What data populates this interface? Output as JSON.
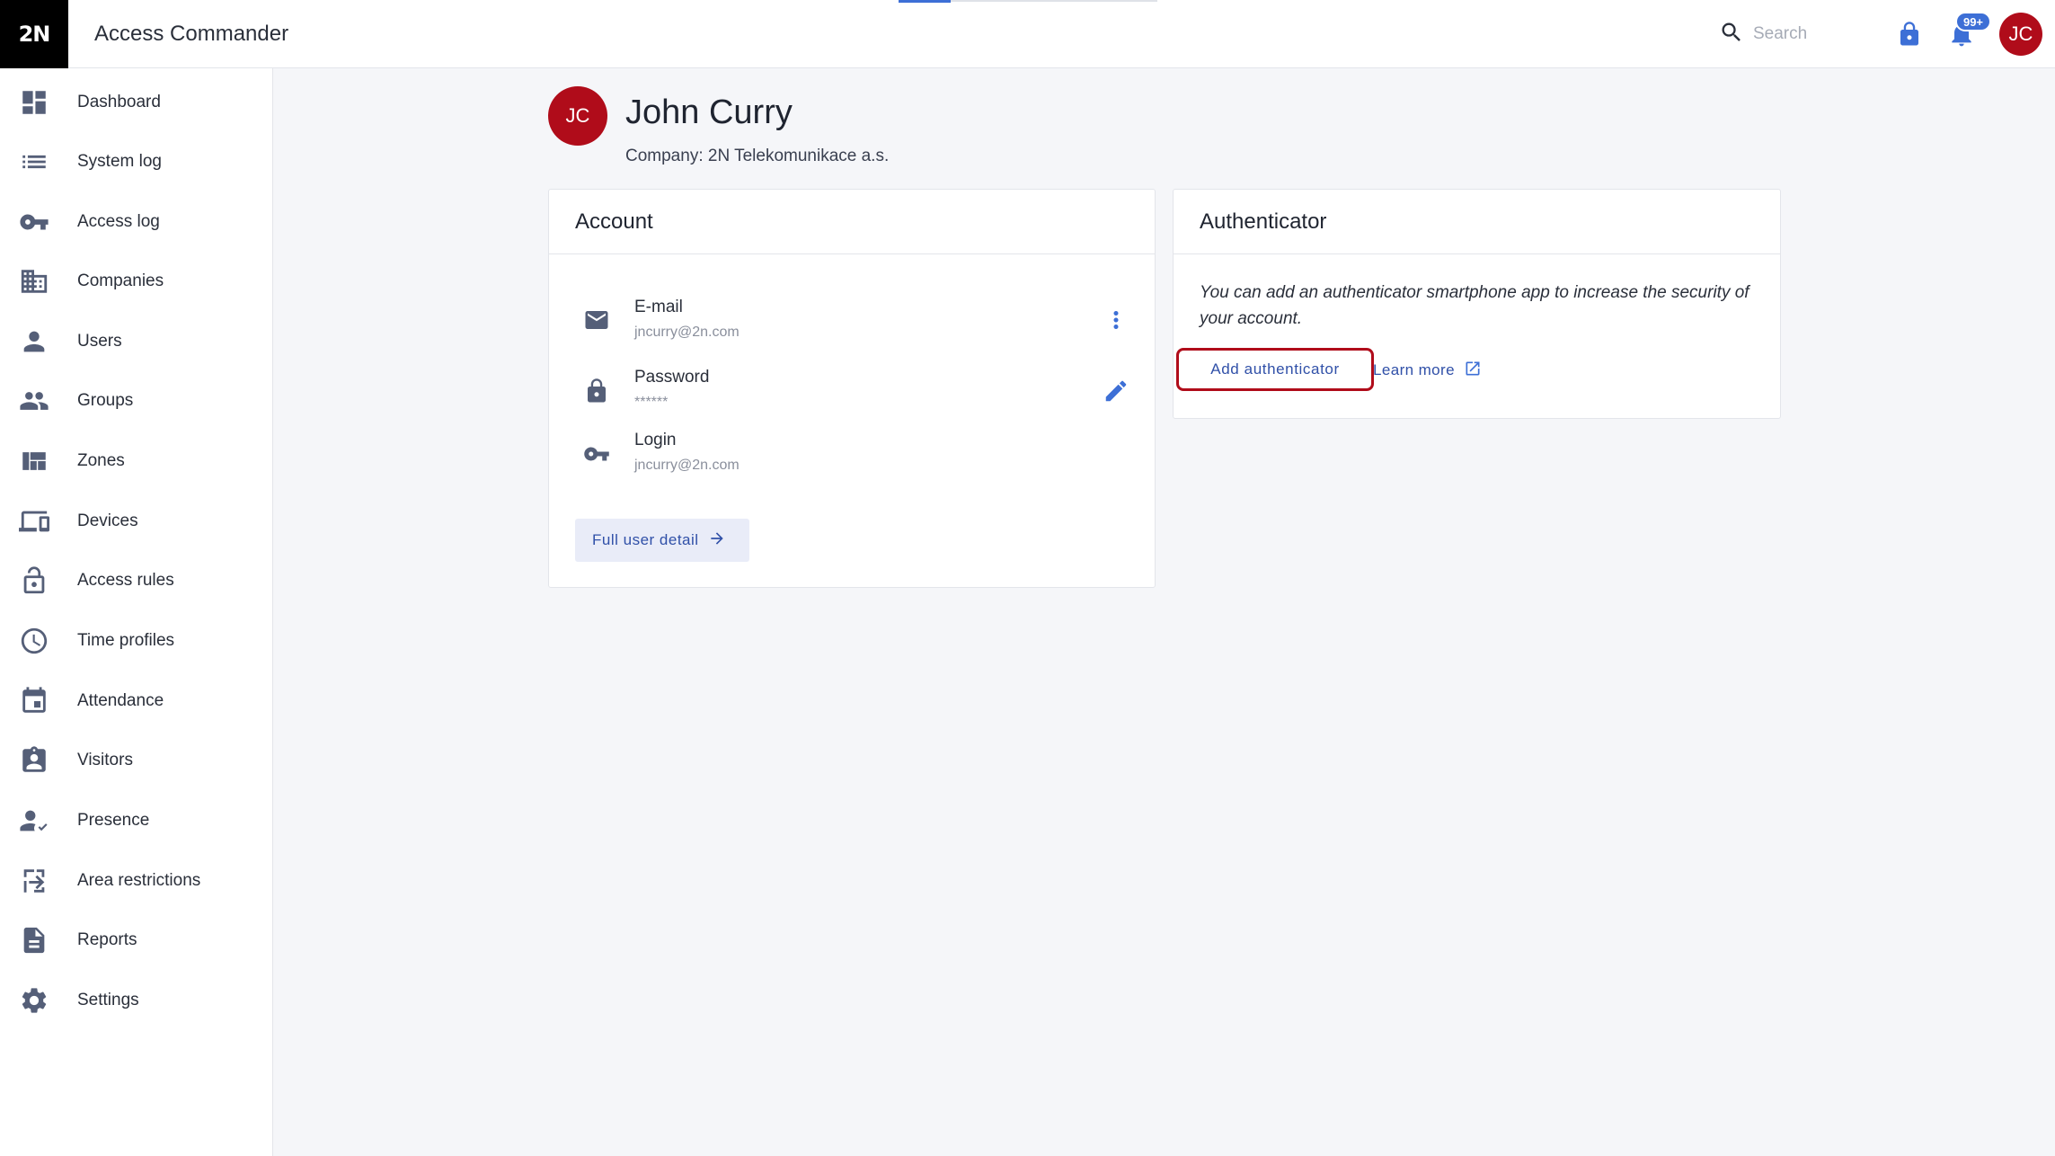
{
  "app": {
    "logo_text": "2N",
    "title": "Access Commander"
  },
  "header": {
    "search_placeholder": "Search",
    "notifications_badge": "99+",
    "avatar_initials": "JC",
    "icons": [
      "search-icon",
      "lock-icon",
      "bell-icon"
    ]
  },
  "sidebar": {
    "items": [
      {
        "label": "Dashboard",
        "icon": "dashboard-icon"
      },
      {
        "label": "System log",
        "icon": "list-icon"
      },
      {
        "label": "Access log",
        "icon": "key-icon"
      },
      {
        "label": "Companies",
        "icon": "building-icon"
      },
      {
        "label": "Users",
        "icon": "person-icon"
      },
      {
        "label": "Groups",
        "icon": "people-icon"
      },
      {
        "label": "Zones",
        "icon": "zones-icon"
      },
      {
        "label": "Devices",
        "icon": "devices-icon"
      },
      {
        "label": "Access rules",
        "icon": "lock-open-icon"
      },
      {
        "label": "Time profiles",
        "icon": "clock-icon"
      },
      {
        "label": "Attendance",
        "icon": "calendar-icon"
      },
      {
        "label": "Visitors",
        "icon": "badge-icon"
      },
      {
        "label": "Presence",
        "icon": "person-check-icon"
      },
      {
        "label": "Area restrictions",
        "icon": "area-restriction-icon"
      },
      {
        "label": "Reports",
        "icon": "document-icon"
      },
      {
        "label": "Settings",
        "icon": "gear-icon"
      }
    ]
  },
  "profile": {
    "initials": "JC",
    "name": "John Curry",
    "company": "Company: 2N Telekomunikace a.s."
  },
  "account": {
    "title": "Account",
    "rows": [
      {
        "label": "E-mail",
        "value": "jncurry@2n.com",
        "icon": "mail-icon",
        "action_icon": "more-vert-icon"
      },
      {
        "label": "Password",
        "value": "******",
        "icon": "lock-icon",
        "action_icon": "pencil-icon"
      },
      {
        "label": "Login",
        "value": "jncurry@2n.com",
        "icon": "key-icon"
      }
    ],
    "full_detail_label": "Full user detail"
  },
  "authenticator": {
    "title": "Authenticator",
    "description": "You can add an authenticator smartphone app to increase the security of your account.",
    "add_label": "Add authenticator",
    "learn_more_label": "Learn more",
    "highlight_color": "#b00c1a"
  },
  "colors": {
    "accent": "#3d6fd6",
    "avatar": "#b00c1a"
  }
}
